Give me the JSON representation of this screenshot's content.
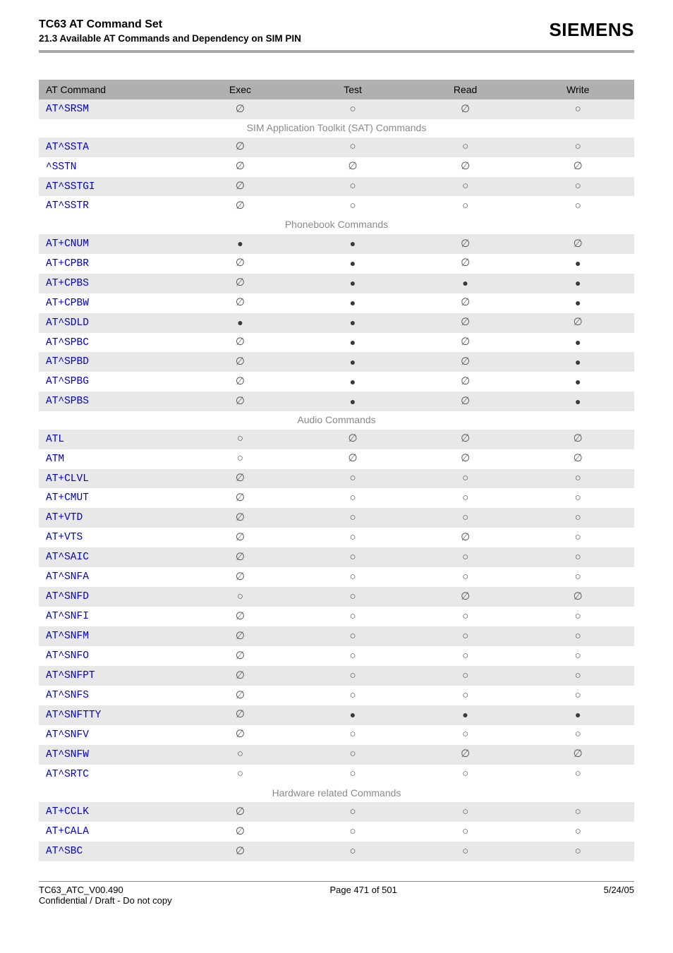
{
  "header": {
    "title": "TC63 AT Command Set",
    "subtitle": "21.3 Available AT Commands and Dependency on SIM PIN",
    "brand": "SIEMENS"
  },
  "symbols": {
    "na": "∅",
    "ring": "○",
    "filled": "●"
  },
  "table": {
    "columns": [
      "AT Command",
      "Exec",
      "Test",
      "Read",
      "Write"
    ],
    "groups": [
      {
        "heading": null,
        "rows": [
          {
            "cmd": "AT^SRSM",
            "exec": "na",
            "test": "ring",
            "read": "na",
            "write": "ring"
          }
        ]
      },
      {
        "heading": "SIM Application Toolkit (SAT) Commands",
        "rows": [
          {
            "cmd": "AT^SSTA",
            "exec": "na",
            "test": "ring",
            "read": "ring",
            "write": "ring"
          },
          {
            "cmd": "^SSTN",
            "exec": "na",
            "test": "na",
            "read": "na",
            "write": "na"
          },
          {
            "cmd": "AT^SSTGI",
            "exec": "na",
            "test": "ring",
            "read": "ring",
            "write": "ring"
          },
          {
            "cmd": "AT^SSTR",
            "exec": "na",
            "test": "ring",
            "read": "ring",
            "write": "ring"
          }
        ]
      },
      {
        "heading": "Phonebook Commands",
        "rows": [
          {
            "cmd": "AT+CNUM",
            "exec": "filled",
            "test": "filled",
            "read": "na",
            "write": "na"
          },
          {
            "cmd": "AT+CPBR",
            "exec": "na",
            "test": "filled",
            "read": "na",
            "write": "filled"
          },
          {
            "cmd": "AT+CPBS",
            "exec": "na",
            "test": "filled",
            "read": "filled",
            "write": "filled"
          },
          {
            "cmd": "AT+CPBW",
            "exec": "na",
            "test": "filled",
            "read": "na",
            "write": "filled"
          },
          {
            "cmd": "AT^SDLD",
            "exec": "filled",
            "test": "filled",
            "read": "na",
            "write": "na"
          },
          {
            "cmd": "AT^SPBC",
            "exec": "na",
            "test": "filled",
            "read": "na",
            "write": "filled"
          },
          {
            "cmd": "AT^SPBD",
            "exec": "na",
            "test": "filled",
            "read": "na",
            "write": "filled"
          },
          {
            "cmd": "AT^SPBG",
            "exec": "na",
            "test": "filled",
            "read": "na",
            "write": "filled"
          },
          {
            "cmd": "AT^SPBS",
            "exec": "na",
            "test": "filled",
            "read": "na",
            "write": "filled"
          }
        ]
      },
      {
        "heading": "Audio Commands",
        "rows": [
          {
            "cmd": "ATL",
            "exec": "ring",
            "test": "na",
            "read": "na",
            "write": "na"
          },
          {
            "cmd": "ATM",
            "exec": "ring",
            "test": "na",
            "read": "na",
            "write": "na"
          },
          {
            "cmd": "AT+CLVL",
            "exec": "na",
            "test": "ring",
            "read": "ring",
            "write": "ring"
          },
          {
            "cmd": "AT+CMUT",
            "exec": "na",
            "test": "ring",
            "read": "ring",
            "write": "ring"
          },
          {
            "cmd": "AT+VTD",
            "exec": "na",
            "test": "ring",
            "read": "ring",
            "write": "ring"
          },
          {
            "cmd": "AT+VTS",
            "exec": "na",
            "test": "ring",
            "read": "na",
            "write": "ring"
          },
          {
            "cmd": "AT^SAIC",
            "exec": "na",
            "test": "ring",
            "read": "ring",
            "write": "ring"
          },
          {
            "cmd": "AT^SNFA",
            "exec": "na",
            "test": "ring",
            "read": "ring",
            "write": "ring"
          },
          {
            "cmd": "AT^SNFD",
            "exec": "ring",
            "test": "ring",
            "read": "na",
            "write": "na"
          },
          {
            "cmd": "AT^SNFI",
            "exec": "na",
            "test": "ring",
            "read": "ring",
            "write": "ring"
          },
          {
            "cmd": "AT^SNFM",
            "exec": "na",
            "test": "ring",
            "read": "ring",
            "write": "ring"
          },
          {
            "cmd": "AT^SNFO",
            "exec": "na",
            "test": "ring",
            "read": "ring",
            "write": "ring"
          },
          {
            "cmd": "AT^SNFPT",
            "exec": "na",
            "test": "ring",
            "read": "ring",
            "write": "ring"
          },
          {
            "cmd": "AT^SNFS",
            "exec": "na",
            "test": "ring",
            "read": "ring",
            "write": "ring"
          },
          {
            "cmd": "AT^SNFTTY",
            "exec": "na",
            "test": "filled",
            "read": "filled",
            "write": "filled"
          },
          {
            "cmd": "AT^SNFV",
            "exec": "na",
            "test": "ring",
            "read": "ring",
            "write": "ring"
          },
          {
            "cmd": "AT^SNFW",
            "exec": "ring",
            "test": "ring",
            "read": "na",
            "write": "na"
          },
          {
            "cmd": "AT^SRTC",
            "exec": "ring",
            "test": "ring",
            "read": "ring",
            "write": "ring"
          }
        ]
      },
      {
        "heading": "Hardware related Commands",
        "rows": [
          {
            "cmd": "AT+CCLK",
            "exec": "na",
            "test": "ring",
            "read": "ring",
            "write": "ring"
          },
          {
            "cmd": "AT+CALA",
            "exec": "na",
            "test": "ring",
            "read": "ring",
            "write": "ring"
          },
          {
            "cmd": "AT^SBC",
            "exec": "na",
            "test": "ring",
            "read": "ring",
            "write": "ring"
          }
        ]
      }
    ]
  },
  "footer": {
    "left_top": "TC63_ATC_V00.490",
    "center_top": "Page 471 of 501",
    "right_top": "5/24/05",
    "left_bottom": "Confidential / Draft - Do not copy"
  }
}
